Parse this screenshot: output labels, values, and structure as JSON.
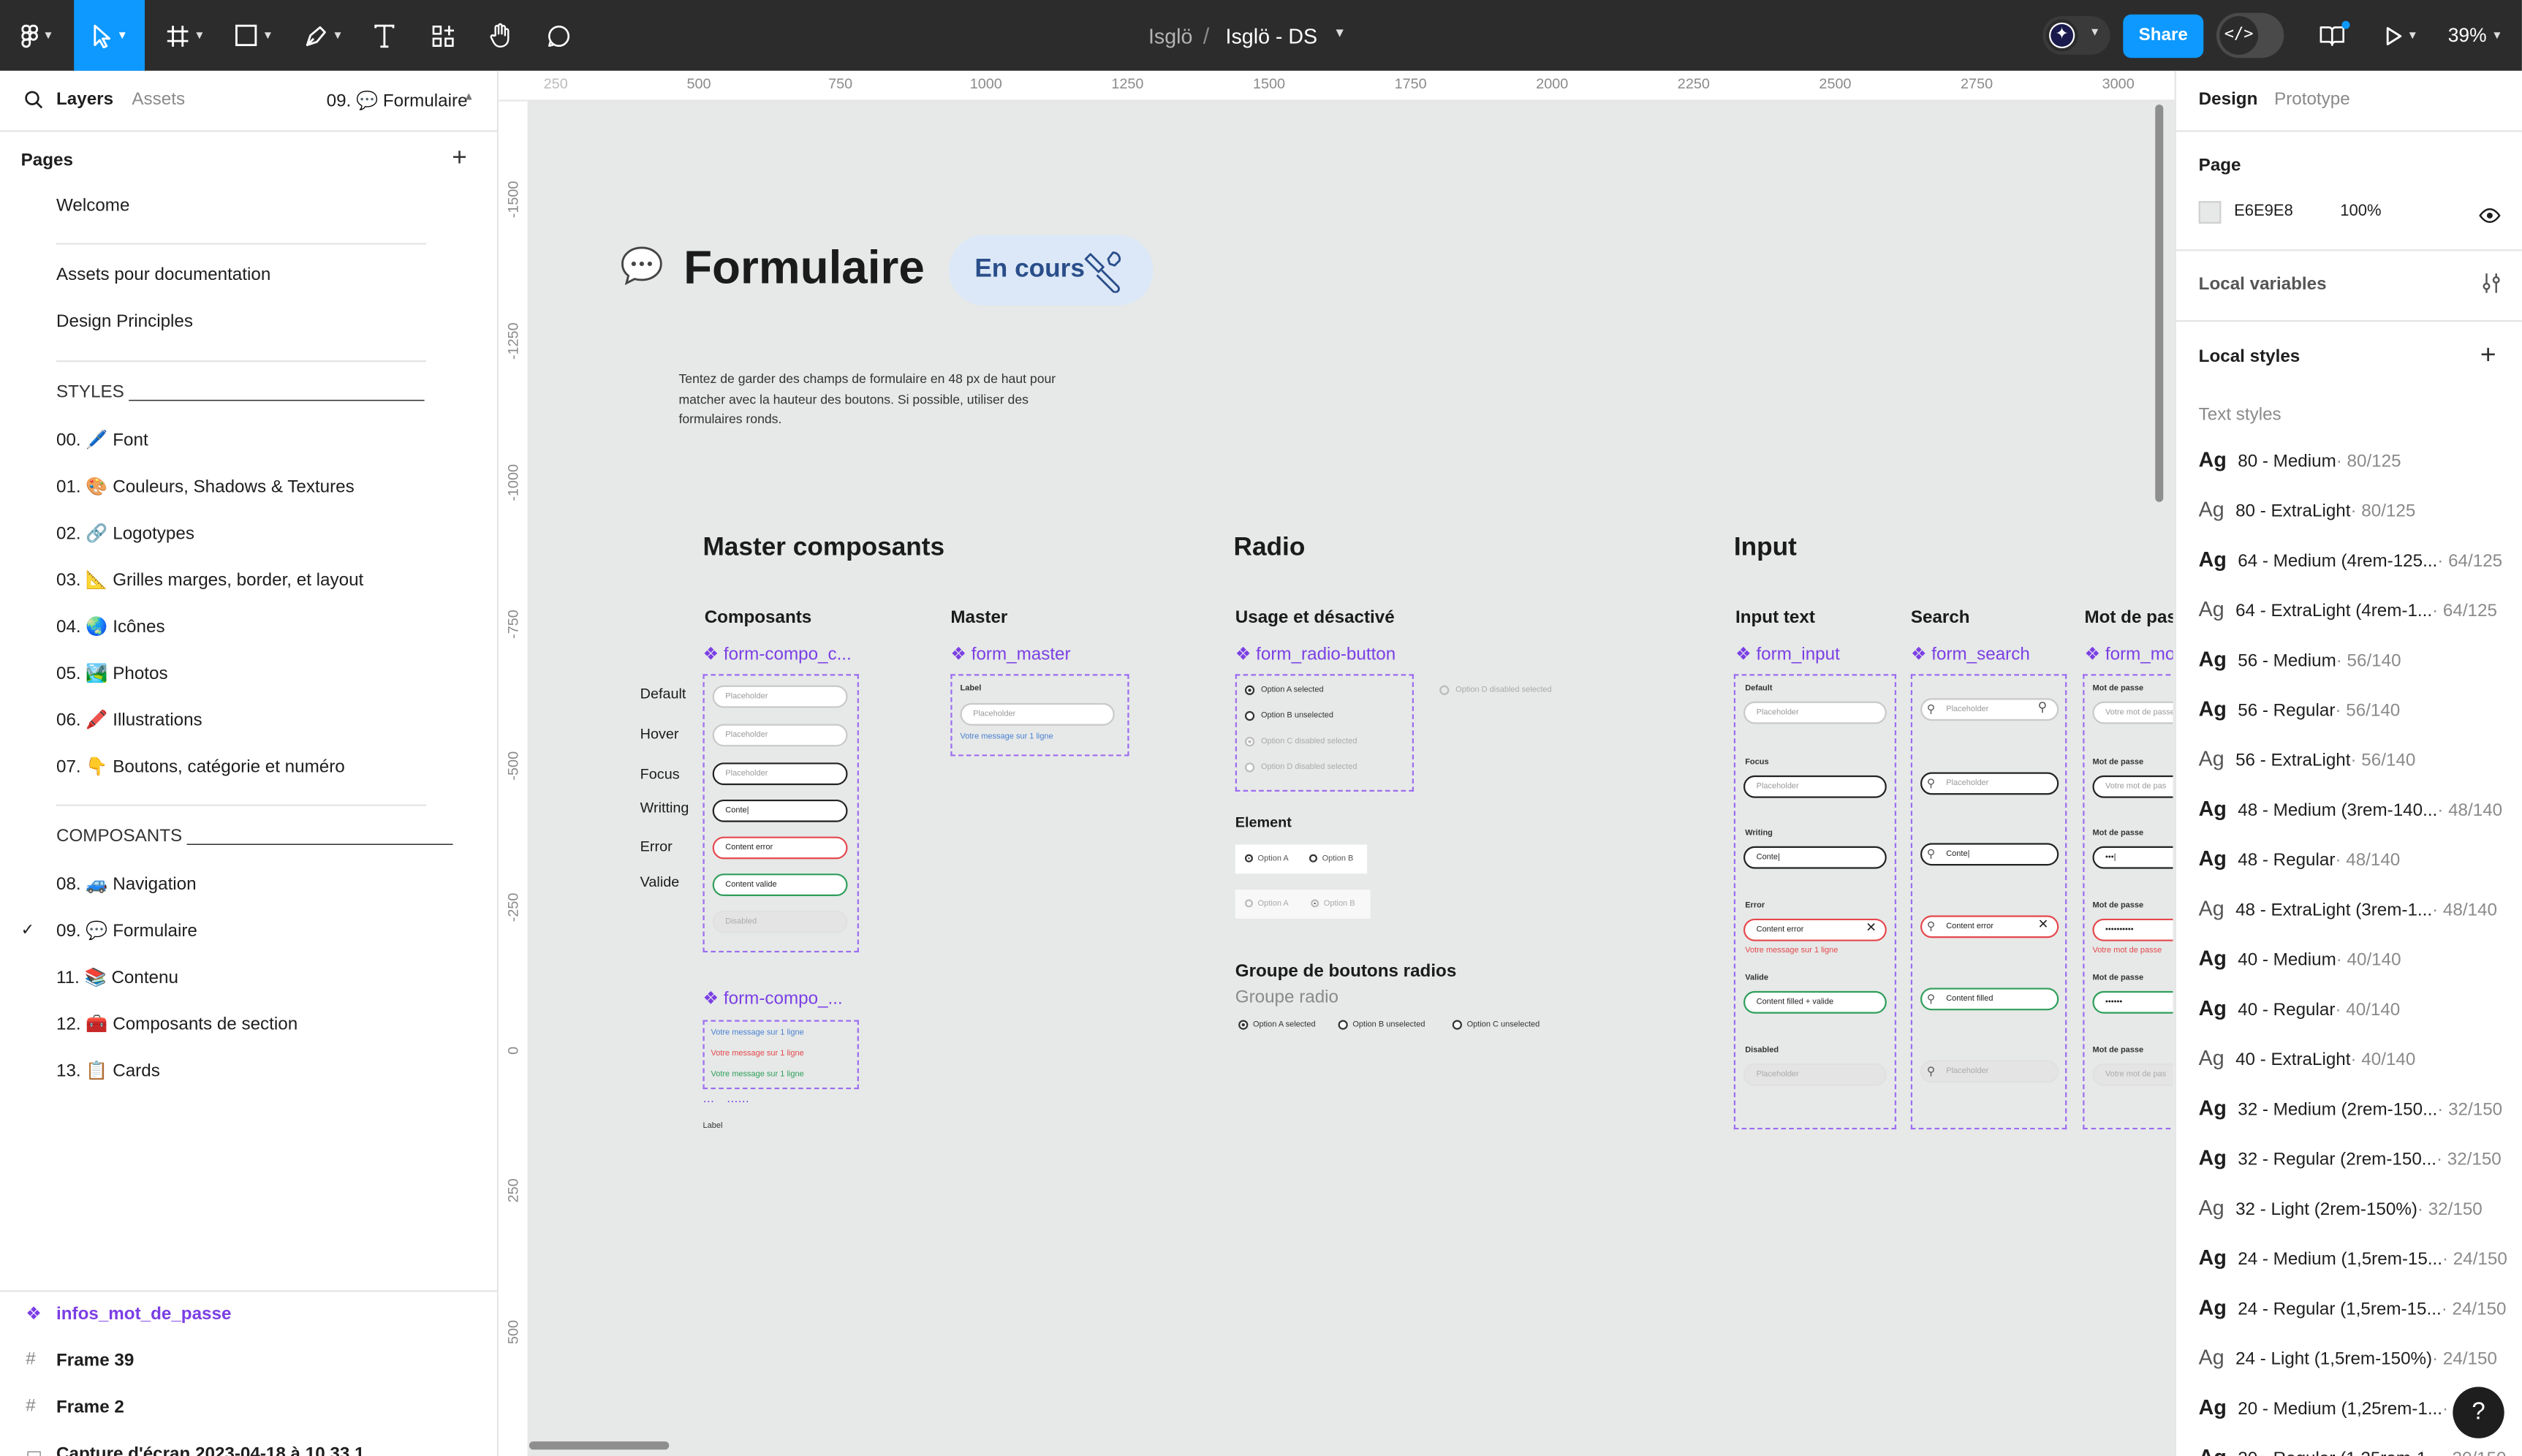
{
  "toolbar": {
    "breadcrumb_project": "Isglö",
    "breadcrumb_sep": "/",
    "file_name": "Isglö - DS",
    "share_label": "Share",
    "zoom": "39%"
  },
  "left_panel": {
    "tab_layers": "Layers",
    "tab_assets": "Assets",
    "current_page": "09. 💬 Formulaire",
    "pages_title": "Pages",
    "pages": [
      "Welcome",
      "Assets pour documentation",
      "Design Principles",
      "STYLES ______________________________",
      "00. 🖊️ Font",
      "01. 🎨  Couleurs, Shadows & Textures",
      "02. 🔗 Logotypes",
      "03. 📐  Grilles marges, border, et layout",
      "04. 🌏 Icônes",
      "05. 🏞️  Photos",
      "06. 🖍️ Illustrations",
      "07. 👇  Boutons, catégorie et numéro",
      "COMPOSANTS ___________________________",
      "08. 🚙  Navigation",
      "09. 💬  Formulaire",
      "11. 📚  Contenu",
      "12. 🧰 Composants de section",
      "13. 📋  Cards"
    ],
    "layers": [
      "infos_mot_de_passe",
      "Frame 39",
      "Frame 2",
      "Capture d'écran 2023-04-18 à 10.33.1"
    ]
  },
  "rulers": {
    "top": [
      "250",
      "500",
      "750",
      "1000",
      "1250",
      "1500",
      "1750",
      "2000",
      "2250",
      "2500",
      "2750",
      "3000"
    ],
    "left": [
      "-1500",
      "-1250",
      "-1000",
      "-750",
      "-500",
      "-250",
      "0",
      "250",
      "500"
    ]
  },
  "canvas": {
    "page_title": "Formulaire",
    "status_badge": "En cours",
    "description": "Tentez de garder des champs de formulaire en 48 px de haut pour matcher avec la hauteur des boutons. Si possible, utiliser des formulaires ronds.",
    "master": {
      "title": "Master composants",
      "composants_label": "Composants",
      "master_label": "Master",
      "comp1": "form-compo_c...",
      "comp_master": "form_master",
      "comp2": "form-compo_...",
      "states": [
        "Default",
        "Hover",
        "Focus",
        "Writting",
        "Error",
        "Valide"
      ],
      "fields": [
        "Placeholder",
        "Placeholder",
        "Placeholder",
        "Conte|",
        "Content error",
        "Content valide",
        "Disabled"
      ],
      "master_field_label": "Label",
      "master_field_placeholder": "Placeholder",
      "master_message": "Votre message sur 1 ligne",
      "messages": [
        "Votre message sur 1 ligne",
        "Votre message sur 1 ligne",
        "Votre message sur 1 ligne"
      ],
      "label_small": "Label"
    },
    "radio": {
      "title": "Radio",
      "usage_label": "Usage et désactivé",
      "comp": "form_radio-button",
      "options": [
        "Option A selected",
        "Option B unselected",
        "Option C disabled selected",
        "Option D disabled selected"
      ],
      "option_d_outside": "Option D disabled selected",
      "element_label": "Element",
      "element_options": [
        "Option A",
        "Option B",
        "Option A",
        "Option B"
      ],
      "group_title": "Groupe de boutons radios",
      "group_sub": "Groupe radio",
      "group_options": [
        "Option A selected",
        "Option B unselected",
        "Option C unselected"
      ]
    },
    "input": {
      "title": "Input",
      "input_text_label": "Input text",
      "search_label": "Search",
      "password_label": "Mot de pas",
      "comp_input": "form_input",
      "comp_search": "form_search",
      "comp_password": "form_mo",
      "input_states": [
        "Default",
        "Focus",
        "Writing",
        "Error",
        "Valide",
        "Disabled"
      ],
      "input_values": [
        "Placeholder",
        "Placeholder",
        "Conte|",
        "Content error",
        "Content filled + valide",
        "Placeholder"
      ],
      "error_message": "Votre message sur 1 ligne",
      "search_values": [
        "Placeholder",
        "Placeholder",
        "Conte|",
        "Content error",
        "Content filled",
        "Placeholder"
      ],
      "password_label_small": "Mot de passe",
      "password_values": [
        "Votre mot de passe",
        "Votre mot de pas",
        "•••|",
        "••••••••••",
        "••••••",
        "Votre mot de pas"
      ],
      "password_error": "Votre mot de passe"
    }
  },
  "right_panel": {
    "tab_design": "Design",
    "tab_prototype": "Prototype",
    "page_title": "Page",
    "page_color": "E6E9E8",
    "page_opacity": "100%",
    "local_variables": "Local variables",
    "local_styles": "Local styles",
    "text_styles_title": "Text styles",
    "text_styles": [
      {
        "name": "80 - Medium",
        "size": "· 80/125",
        "weight": "b"
      },
      {
        "name": "80 - ExtraLight",
        "size": "· 80/125",
        "weight": "l"
      },
      {
        "name": "64 - Medium (4rem-125...",
        "size": "· 64/125",
        "weight": "b"
      },
      {
        "name": "64 - ExtraLight (4rem-1...",
        "size": "· 64/125",
        "weight": "l"
      },
      {
        "name": "56 - Medium",
        "size": "· 56/140",
        "weight": "b"
      },
      {
        "name": "56 - Regular",
        "size": "· 56/140",
        "weight": "b"
      },
      {
        "name": "56 - ExtraLight",
        "size": "· 56/140",
        "weight": "l"
      },
      {
        "name": "48 - Medium (3rem-140...",
        "size": "· 48/140",
        "weight": "b"
      },
      {
        "name": "48 - Regular",
        "size": "· 48/140",
        "weight": "b"
      },
      {
        "name": "48 - ExtraLight (3rem-1...",
        "size": "· 48/140",
        "weight": "l"
      },
      {
        "name": "40 - Medium",
        "size": "· 40/140",
        "weight": "b"
      },
      {
        "name": "40 - Regular",
        "size": "· 40/140",
        "weight": "b"
      },
      {
        "name": "40 - ExtraLight",
        "size": "· 40/140",
        "weight": "l"
      },
      {
        "name": "32 - Medium (2rem-150...",
        "size": "· 32/150",
        "weight": "b"
      },
      {
        "name": "32 - Regular (2rem-150...",
        "size": "· 32/150",
        "weight": "b"
      },
      {
        "name": "32 - Light (2rem-150%)",
        "size": "· 32/150",
        "weight": "l"
      },
      {
        "name": "24 - Medium (1,5rem-15...",
        "size": "· 24/150",
        "weight": "b"
      },
      {
        "name": "24 - Regular (1,5rem-15...",
        "size": "· 24/150",
        "weight": "b"
      },
      {
        "name": "24 - Light (1,5rem-150%)",
        "size": "· 24/150",
        "weight": "l"
      },
      {
        "name": "20 - Medium (1,25rem-1...",
        "size": "· 2",
        "weight": "b"
      },
      {
        "name": "20 - Regular (1,25rem-1...",
        "size": "· 20/150",
        "weight": "b"
      }
    ],
    "ag_glyph": "Ag",
    "help": "?"
  },
  "colors": {
    "toolbar_bg": "#2c2c2c",
    "accent": "#0d99ff",
    "component_purple": "#7b3fe4",
    "canvas_bg": "#e6e9e8",
    "error": "#e5484d",
    "valid": "#2f9e5a"
  }
}
